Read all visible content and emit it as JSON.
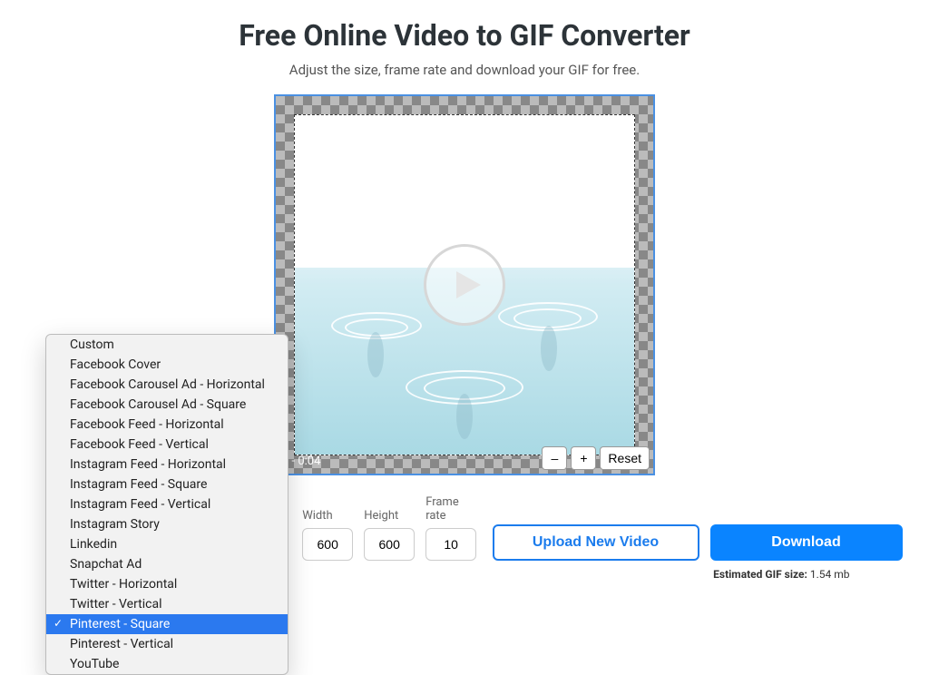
{
  "header": {
    "title": "Free Online Video to GIF Converter",
    "subtitle": "Adjust the size, frame rate and download your GIF for free."
  },
  "preview": {
    "time_label": "0 - 0:04",
    "zoom": {
      "out": "–",
      "in": "+",
      "reset": "Reset"
    }
  },
  "fields": {
    "width": {
      "label": "Width",
      "value": "600"
    },
    "height": {
      "label": "Height",
      "value": "600"
    },
    "fps": {
      "label": "Frame rate",
      "value": "10"
    }
  },
  "buttons": {
    "upload": "Upload New Video",
    "download": "Download"
  },
  "estimate": {
    "label": "Estimated GIF size:",
    "value": "1.54 mb"
  },
  "size_presets": {
    "selected_index": 14,
    "options": [
      "Custom",
      "Facebook Cover",
      "Facebook Carousel Ad - Horizontal",
      "Facebook Carousel Ad - Square",
      "Facebook Feed - Horizontal",
      "Facebook Feed - Vertical",
      "Instagram Feed - Horizontal",
      "Instagram Feed - Square",
      "Instagram Feed - Vertical",
      "Instagram Story",
      "Linkedin",
      "Snapchat Ad",
      "Twitter - Horizontal",
      "Twitter - Vertical",
      "Pinterest - Square",
      "Pinterest - Vertical",
      "YouTube"
    ]
  }
}
